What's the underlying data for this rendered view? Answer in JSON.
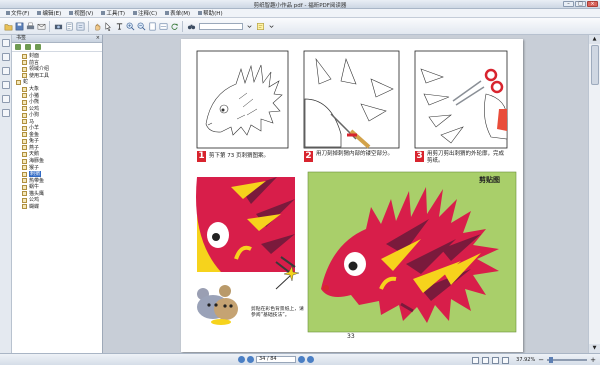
{
  "window": {
    "title": "剪纸智趣小作品 pdf - 福昕PDF阅读器",
    "min": "–",
    "max": "□",
    "close": "×"
  },
  "menu": [
    "文件(F)",
    "编辑(E)",
    "视图(V)",
    "工具(T)",
    "注释(C)",
    "表单(M)",
    "帮助(H)"
  ],
  "toolbar": {
    "search_placeholder": ""
  },
  "bookmarks": {
    "header": "书签",
    "close": "×",
    "items": [
      {
        "label": "封面",
        "level": 1
      },
      {
        "label": "前言",
        "level": 1
      },
      {
        "label": "领域介绍",
        "level": 1
      },
      {
        "label": "使用工具",
        "level": 1
      },
      {
        "label": "蛇",
        "level": 0
      },
      {
        "label": "大象",
        "level": 1
      },
      {
        "label": "小猪",
        "level": 1
      },
      {
        "label": "小熊",
        "level": 1
      },
      {
        "label": "公鸡",
        "level": 1
      },
      {
        "label": "小狗",
        "level": 1
      },
      {
        "label": "马",
        "level": 1
      },
      {
        "label": "小羊",
        "level": 1
      },
      {
        "label": "金鱼",
        "level": 1
      },
      {
        "label": "兔子",
        "level": 1
      },
      {
        "label": "燕子",
        "level": 1
      },
      {
        "label": "天鹅",
        "level": 1
      },
      {
        "label": "海豚鱼",
        "level": 1
      },
      {
        "label": "猴子",
        "level": 1
      },
      {
        "label": "刺猬",
        "level": 1,
        "selected": true
      },
      {
        "label": "热带鱼",
        "level": 1
      },
      {
        "label": "蜗牛",
        "level": 1
      },
      {
        "label": "猫头鹰",
        "level": 1
      },
      {
        "label": "公鸡",
        "level": 1
      },
      {
        "label": "蝴蝶",
        "level": 1
      }
    ]
  },
  "page": {
    "steps": [
      {
        "num": "1",
        "text": "剪下第 73 页刺猬图案。"
      },
      {
        "num": "2",
        "text": "用刀刻掉刺猬内部的镂空部分。"
      },
      {
        "num": "3",
        "text": "用剪刀剪出刺猬的外轮廓，完成剪纸。"
      }
    ],
    "paste_title": "剪贴图",
    "note": "剪贴在彩色背景纸上，请参阅“基础技法”。",
    "page_number": "33"
  },
  "status": {
    "page_input": "34 / 84",
    "zoom": "37.92%"
  },
  "colors": {
    "accent_red": "#d8242e",
    "hedgehog_red": "#d81e4a",
    "yellow": "#f6d31c",
    "green_bg": "#a9cf6a"
  }
}
